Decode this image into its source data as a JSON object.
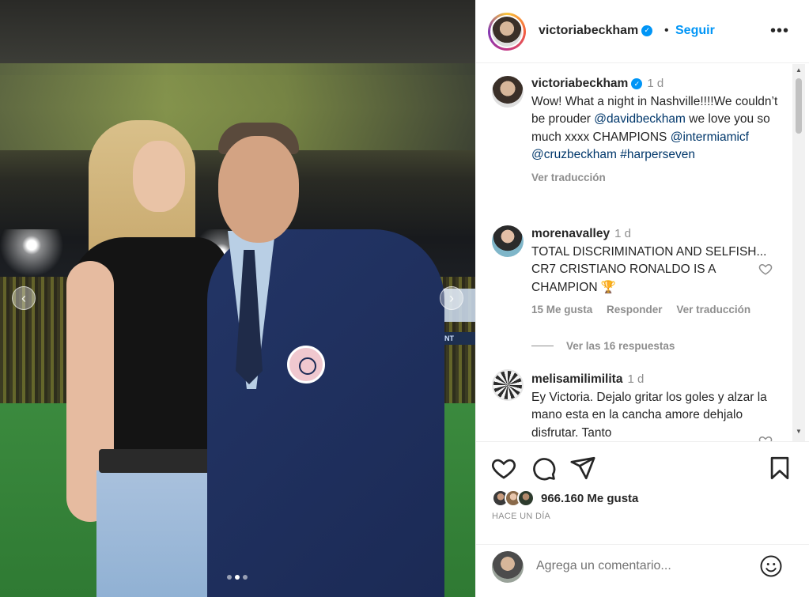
{
  "post": {
    "author": "victoriabeckham",
    "follow_label": "Seguir",
    "separator": "•",
    "more_label": "•••",
    "carousel": {
      "total_slides": 3,
      "active_slide": 2
    },
    "photo_banner_text": "RENASANT"
  },
  "caption": {
    "author": "victoriabeckham",
    "time": "1 d",
    "text_1": "Wow! What a night in Nashville!!!!We couldn’t be prouder ",
    "mention_1": "@davidbeckham",
    "text_2": " we love you so much xxxx CHAMPIONS ",
    "mention_2": "@intermiamicf",
    "mention_3": "@cruzbeckham",
    "hashtag_1": "#harperseven",
    "translate_label": "Ver traducción"
  },
  "comments": [
    {
      "author": "morenavalley",
      "time": "1 d",
      "text": "TOTAL DISCRIMINATION AND SELFISH... CR7 CRISTIANO RONALDO IS A CHAMPION 🏆",
      "likes_label": "15 Me gusta",
      "reply_label": "Responder",
      "translate_label": "Ver traducción",
      "replies_label": "Ver las 16 respuestas"
    },
    {
      "author": "melisamilimilita",
      "time": "1 d",
      "text": "Ey Victoria. Dejalo gritar los goles y alzar la mano esta en la cancha amore dehjalo disfrutar. Tanto"
    }
  ],
  "actions": {
    "likes_count_label": "966.160 Me gusta",
    "posted_ago": "HACE UN DÍA"
  },
  "comment_input": {
    "placeholder": "Agrega un comentario..."
  },
  "colors": {
    "accent": "#0095f6",
    "link": "#00376b",
    "muted": "#8e8e8e",
    "text": "#262626"
  },
  "icons": [
    "chevron-left-icon",
    "chevron-right-icon",
    "verified-icon",
    "more-icon",
    "heart-icon",
    "comment-icon",
    "share-icon",
    "bookmark-icon",
    "emoji-icon"
  ]
}
